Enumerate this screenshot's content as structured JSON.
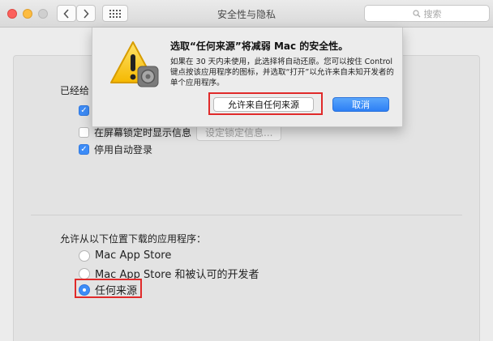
{
  "window": {
    "title": "安全性与隐私",
    "search_placeholder": "搜索"
  },
  "general": {
    "login_label_visible": "已经给",
    "show_message_label": "在屏幕锁定时显示信息",
    "set_lock_message_button": "设定锁定信息...",
    "disable_autologin_label": "停用自动登录",
    "require_password_checked": true,
    "show_message_checked": false,
    "disable_autologin_checked": true
  },
  "downloads": {
    "heading": "允许从以下位置下载的应用程序：",
    "options": [
      {
        "label": "Mac App Store",
        "selected": false
      },
      {
        "label": "Mac App Store 和被认可的开发者",
        "selected": false
      },
      {
        "label": "任何来源",
        "selected": true
      }
    ]
  },
  "dialog": {
    "title": "选取“任何来源”将减弱 Mac 的安全性。",
    "body": "如果在 30 天内未使用，此选择将自动还原。您可以按住 Control 键点按该应用程序的图标，并选取“打开”以允许来自未知开发者的单个应用程序。",
    "allow_button": "允许来自任何来源",
    "cancel_button": "取消"
  },
  "colors": {
    "accent": "#3d8cf7",
    "highlight": "#e02a2a"
  }
}
